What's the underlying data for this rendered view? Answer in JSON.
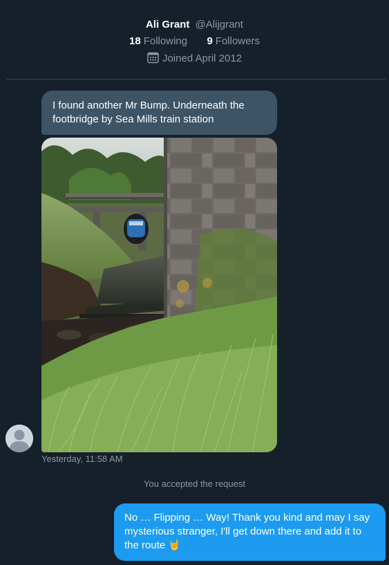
{
  "profile": {
    "display_name": "Ali Grant",
    "handle": "@Alijgrant",
    "following_count": "18",
    "following_label": "Following",
    "followers_count": "9",
    "followers_label": "Followers",
    "joined_text": "Joined April 2012"
  },
  "messages": {
    "incoming_text": "I found another Mr Bump. Underneath the footbridge by Sea Mills train station",
    "incoming_photo_icon": "photo-footbridge-stream",
    "incoming_timestamp": "Yesterday, 11:58 AM",
    "system_text": "You accepted the request",
    "outgoing_text": "No … Flipping … Way! Thank you kind and may I say mysterious stranger, I'll get down there and add it to the route 🤘"
  },
  "colors": {
    "background": "#15202b",
    "incoming_bubble": "#3d5466",
    "outgoing_bubble": "#1d9bf0",
    "secondary_text": "#8b98a5",
    "divider": "#38444d"
  }
}
